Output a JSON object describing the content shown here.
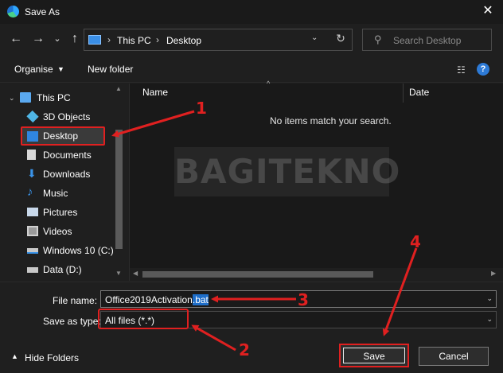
{
  "window": {
    "title": "Save As",
    "close_glyph": "✕"
  },
  "nav": {
    "back_glyph": "←",
    "forward_glyph": "→",
    "recent_glyph": "⌄",
    "up_glyph": "↑",
    "breadcrumbs": [
      "This PC",
      "Desktop"
    ],
    "search_placeholder": "Search Desktop",
    "refresh_glyph": "↻",
    "search_glyph": "⚲"
  },
  "toolbar": {
    "organise_label": "Organise",
    "new_folder_label": "New folder",
    "help_glyph": "?"
  },
  "sidebar": {
    "items": [
      {
        "label": "This PC",
        "icon": "computer-icon",
        "color": "#5aa9f0"
      },
      {
        "label": "3D Objects",
        "icon": "cube-icon",
        "color": "#4fb6e6"
      },
      {
        "label": "Desktop",
        "icon": "desktop-icon",
        "color": "#2f86e0",
        "selected": true
      },
      {
        "label": "Documents",
        "icon": "documents-icon",
        "color": "#d8d8d8"
      },
      {
        "label": "Downloads",
        "icon": "download-icon",
        "color": "#3a93e8"
      },
      {
        "label": "Music",
        "icon": "music-icon",
        "color": "#3a93e8"
      },
      {
        "label": "Pictures",
        "icon": "pictures-icon",
        "color": "#c8d8ea"
      },
      {
        "label": "Videos",
        "icon": "videos-icon",
        "color": "#c8c8c8"
      },
      {
        "label": "Windows 10 (C:)",
        "icon": "drive-icon",
        "color": "#c8c8c8"
      },
      {
        "label": "Data (D:)",
        "icon": "drive-icon",
        "color": "#c8c8c8"
      }
    ]
  },
  "filelist": {
    "columns": [
      "Name",
      "Date"
    ],
    "empty_message": "No items match your search.",
    "watermark": "BAGITEKNO"
  },
  "form": {
    "file_name_label": "File name:",
    "file_name_base": "Office2019Activation",
    "file_name_ext": ".bat",
    "save_type_label": "Save as type:",
    "save_type_value": "All files (*.*)"
  },
  "footer": {
    "hide_folders_label": "Hide Folders",
    "save_label": "Save",
    "cancel_label": "Cancel"
  },
  "annotations": {
    "labels": [
      "1",
      "2",
      "3",
      "4"
    ],
    "color": "#e02020"
  }
}
